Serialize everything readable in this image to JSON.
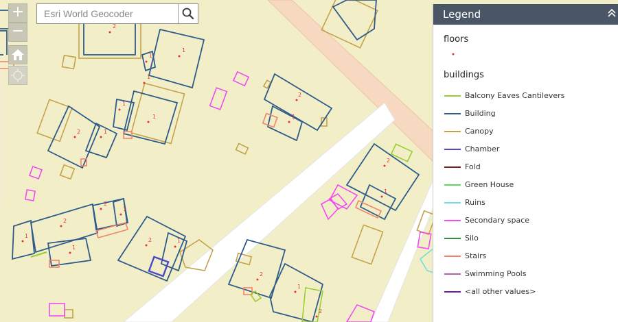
{
  "search": {
    "placeholder": "Esri World Geocoder",
    "value": ""
  },
  "zoom": {
    "in_label": "+",
    "out_label": "−"
  },
  "legend": {
    "title": "Legend",
    "layers": [
      {
        "title": "floors",
        "symbol_color": "#e8323a"
      },
      {
        "title": "buildings",
        "items": [
          {
            "label": "Balcony Eaves Cantilevers",
            "color": "#9acd32"
          },
          {
            "label": "Building",
            "color": "#2f5b8a"
          },
          {
            "label": "Canopy",
            "color": "#c4a24c"
          },
          {
            "label": "Chamber",
            "color": "#4b47c8"
          },
          {
            "label": "Fold",
            "color": "#7a1f1f"
          },
          {
            "label": "Green House",
            "color": "#5adc5a"
          },
          {
            "label": "Ruins",
            "color": "#6fdde3"
          },
          {
            "label": "Secondary space",
            "color": "#f04cf0"
          },
          {
            "label": "Silo",
            "color": "#2f8f3a"
          },
          {
            "label": "Stairs",
            "color": "#f2826a"
          },
          {
            "label": "Swimming Pools",
            "color": "#b25fb0"
          },
          {
            "label": "<all other values>",
            "color": "#6e1ea0"
          }
        ]
      }
    ]
  },
  "map": {
    "background": "#f2efc8",
    "floor_labels": [
      "2",
      "1",
      "1",
      "1",
      "1",
      "2",
      "1",
      "1",
      "2",
      "1",
      "2",
      "2",
      "1",
      "1",
      "2",
      "1",
      "1",
      "2",
      "1",
      "2",
      "1",
      "2",
      "1"
    ]
  }
}
